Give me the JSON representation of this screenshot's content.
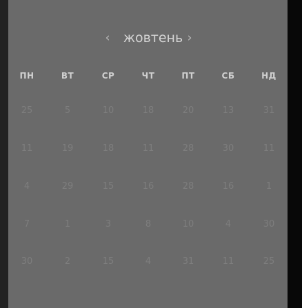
{
  "calendar": {
    "month": "жовтень",
    "prev_symbol": "‹",
    "next_symbol": "›",
    "weekdays": [
      "ПН",
      "ВТ",
      "СР",
      "ЧТ",
      "ПТ",
      "СБ",
      "НД"
    ],
    "weeks": [
      [
        "25",
        "5",
        "10",
        "18",
        "20",
        "13",
        "31"
      ],
      [
        "11",
        "19",
        "18",
        "11",
        "28",
        "30",
        "11"
      ],
      [
        "4",
        "29",
        "15",
        "16",
        "28",
        "16",
        "1"
      ],
      [
        "7",
        "1",
        "3",
        "8",
        "10",
        "4",
        "30"
      ],
      [
        "30",
        "2",
        "15",
        "4",
        "31",
        "11",
        "25"
      ]
    ]
  }
}
